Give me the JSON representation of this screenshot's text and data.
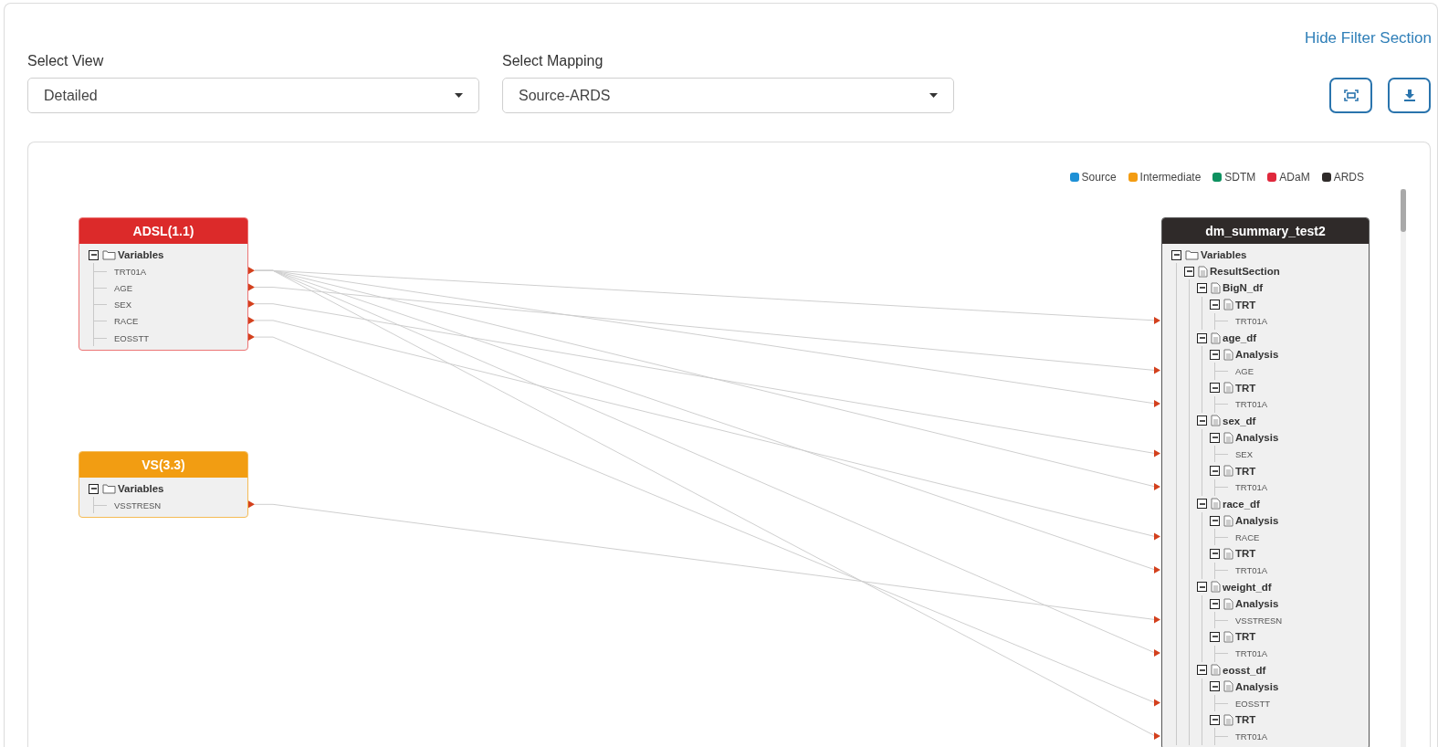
{
  "hide_filter_link": "Hide Filter Section",
  "filters": [
    {
      "label": "Select View",
      "value": "Detailed"
    },
    {
      "label": "Select Mapping",
      "value": "Source-ARDS"
    }
  ],
  "legend": [
    {
      "label": "Source",
      "color": "#1e90d6"
    },
    {
      "label": "Intermediate",
      "color": "#f39c12"
    },
    {
      "label": "SDTM",
      "color": "#0e9160"
    },
    {
      "label": "ADaM",
      "color": "#e0283c"
    },
    {
      "label": "ARDS",
      "color": "#2f2b2a"
    }
  ],
  "nodes": [
    {
      "title": "ADSL(1.1)",
      "kind": "adam",
      "tree": [
        {
          "label": "Variables",
          "kind": "folder",
          "expanded": true,
          "children": [
            {
              "label": "TRT01A",
              "kind": "leaf"
            },
            {
              "label": "AGE",
              "kind": "leaf"
            },
            {
              "label": "SEX",
              "kind": "leaf"
            },
            {
              "label": "RACE",
              "kind": "leaf"
            },
            {
              "label": "EOSSTT",
              "kind": "leaf"
            }
          ]
        }
      ]
    },
    {
      "title": "VS(3.3)",
      "kind": "intermediate",
      "tree": [
        {
          "label": "Variables",
          "kind": "folder",
          "expanded": true,
          "children": [
            {
              "label": "VSSTRESN",
              "kind": "leaf"
            }
          ]
        }
      ]
    },
    {
      "title": "dm_summary_test2",
      "kind": "ards",
      "tree": [
        {
          "label": "Variables",
          "kind": "folder",
          "expanded": true,
          "children": [
            {
              "label": "ResultSection",
              "kind": "doc",
              "expanded": true,
              "children": [
                {
                  "label": "BigN_df",
                  "kind": "doc",
                  "expanded": true,
                  "children": [
                    {
                      "label": "TRT",
                      "kind": "doc",
                      "expanded": true,
                      "children": [
                        {
                          "label": "TRT01A",
                          "kind": "leaf"
                        }
                      ]
                    }
                  ]
                },
                {
                  "label": "age_df",
                  "kind": "doc",
                  "expanded": true,
                  "children": [
                    {
                      "label": "Analysis",
                      "kind": "doc",
                      "expanded": true,
                      "children": [
                        {
                          "label": "AGE",
                          "kind": "leaf"
                        }
                      ]
                    },
                    {
                      "label": "TRT",
                      "kind": "doc",
                      "expanded": true,
                      "children": [
                        {
                          "label": "TRT01A",
                          "kind": "leaf"
                        }
                      ]
                    }
                  ]
                },
                {
                  "label": "sex_df",
                  "kind": "doc",
                  "expanded": true,
                  "children": [
                    {
                      "label": "Analysis",
                      "kind": "doc",
                      "expanded": true,
                      "children": [
                        {
                          "label": "SEX",
                          "kind": "leaf"
                        }
                      ]
                    },
                    {
                      "label": "TRT",
                      "kind": "doc",
                      "expanded": true,
                      "children": [
                        {
                          "label": "TRT01A",
                          "kind": "leaf"
                        }
                      ]
                    }
                  ]
                },
                {
                  "label": "race_df",
                  "kind": "doc",
                  "expanded": true,
                  "children": [
                    {
                      "label": "Analysis",
                      "kind": "doc",
                      "expanded": true,
                      "children": [
                        {
                          "label": "RACE",
                          "kind": "leaf"
                        }
                      ]
                    },
                    {
                      "label": "TRT",
                      "kind": "doc",
                      "expanded": true,
                      "children": [
                        {
                          "label": "TRT01A",
                          "kind": "leaf"
                        }
                      ]
                    }
                  ]
                },
                {
                  "label": "weight_df",
                  "kind": "doc",
                  "expanded": true,
                  "children": [
                    {
                      "label": "Analysis",
                      "kind": "doc",
                      "expanded": true,
                      "children": [
                        {
                          "label": "VSSTRESN",
                          "kind": "leaf"
                        }
                      ]
                    },
                    {
                      "label": "TRT",
                      "kind": "doc",
                      "expanded": true,
                      "children": [
                        {
                          "label": "TRT01A",
                          "kind": "leaf"
                        }
                      ]
                    }
                  ]
                },
                {
                  "label": "eosst_df",
                  "kind": "doc",
                  "expanded": true,
                  "children": [
                    {
                      "label": "Analysis",
                      "kind": "doc",
                      "expanded": true,
                      "children": [
                        {
                          "label": "EOSSTT",
                          "kind": "leaf"
                        }
                      ]
                    },
                    {
                      "label": "TRT",
                      "kind": "doc",
                      "expanded": true,
                      "children": [
                        {
                          "label": "TRT01A",
                          "kind": "leaf"
                        }
                      ]
                    }
                  ]
                }
              ]
            }
          ]
        }
      ]
    }
  ]
}
